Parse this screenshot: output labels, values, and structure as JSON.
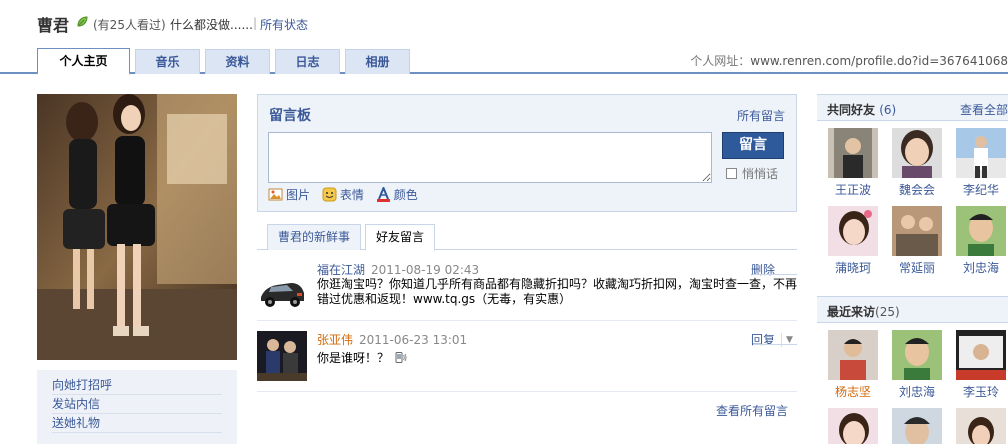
{
  "header": {
    "name": "曹君",
    "visitors": "(有25人看过)",
    "status": "什么都没做......",
    "separator": "|",
    "all_status": "所有状态"
  },
  "tabs": [
    {
      "label": "个人主页",
      "active": true
    },
    {
      "label": "音乐",
      "active": false
    },
    {
      "label": "资料",
      "active": false
    },
    {
      "label": "日志",
      "active": false
    },
    {
      "label": "相册",
      "active": false
    }
  ],
  "site_url": {
    "label": "个人网址：",
    "value": "www.renren.com/profile.do?id=367641068"
  },
  "left_links": [
    "向她打招呼",
    "发站内信",
    "送她礼物"
  ],
  "board": {
    "title": "留言板",
    "all_link": "所有留言",
    "input_value": "",
    "submit": "留言",
    "whisper": "悄悄话",
    "tools": [
      "图片",
      "表情",
      "颜色"
    ]
  },
  "feed_tabs": [
    {
      "label": "曹君的新鲜事",
      "active": false
    },
    {
      "label": "好友留言",
      "active": true
    }
  ],
  "comments": [
    {
      "author": "福在江湖",
      "time": "2011-08-19 02:43",
      "action": "删除",
      "body": "你逛淘宝吗？你知道几乎所有商品都有隐藏折扣吗？收藏淘巧折扣网，淘宝时查一查，不再错过优惠和返现！www.tq.gs（无毒，有实惠）"
    },
    {
      "author": "张亚伟",
      "time": "2011-06-23 13:01",
      "action": "回复",
      "body": "你是谁呀！？"
    }
  ],
  "view_all_messages": "查看所有留言",
  "common_friends": {
    "title": "共同好友",
    "count": "(6)",
    "more": "查看全部",
    "friends": [
      "王正波",
      "魏会会",
      "李纪华",
      "蒲晓珂",
      "常延丽",
      "刘忠海"
    ]
  },
  "recent_visitors": {
    "title": "最近来访",
    "count": "(25)",
    "visitors": [
      "杨志坚",
      "刘忠海",
      "李玉玲"
    ]
  },
  "colors": {
    "link": "#3b5998",
    "accent": "#2e5a9c",
    "highlight": "#d16a0e",
    "panel": "#eef3fa"
  }
}
